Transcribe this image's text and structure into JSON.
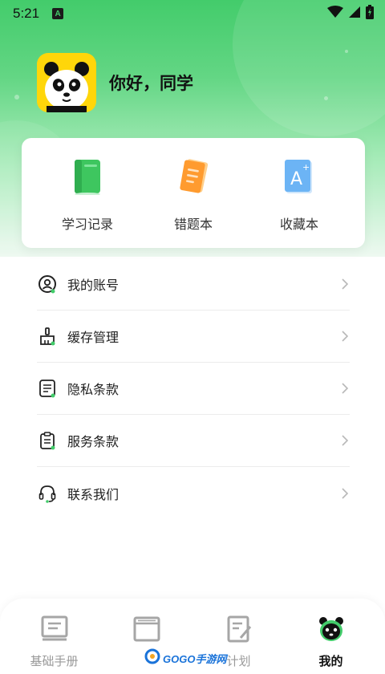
{
  "status_bar": {
    "time": "5:21",
    "notification_letter": "A"
  },
  "profile": {
    "greeting": "你好，同学",
    "avatar_icon": "panda-avatar"
  },
  "quick_actions": [
    {
      "label": "学习记录",
      "icon": "green-book-icon",
      "color": "#3ec65f"
    },
    {
      "label": "错题本",
      "icon": "orange-notebook-icon",
      "color": "#ff9b2f"
    },
    {
      "label": "收藏本",
      "icon": "blue-favorite-icon",
      "color": "#6cb4f5"
    }
  ],
  "menu": [
    {
      "label": "我的账号",
      "icon": "account-icon"
    },
    {
      "label": "缓存管理",
      "icon": "broom-icon"
    },
    {
      "label": "隐私条款",
      "icon": "document-icon"
    },
    {
      "label": "服务条款",
      "icon": "clipboard-icon"
    },
    {
      "label": "联系我们",
      "icon": "headset-icon"
    }
  ],
  "bottom_nav": [
    {
      "label": "基础手册",
      "icon": "manual-icon",
      "active": false
    },
    {
      "label": "",
      "icon": "book-icon",
      "active": false
    },
    {
      "label": "计划",
      "icon": "plan-icon",
      "active": false
    },
    {
      "label": "我的",
      "icon": "panda-icon",
      "active": true
    }
  ],
  "watermark": {
    "text": "GOGO手游网"
  },
  "colors": {
    "accent": "#43cc6b",
    "text": "#1f1f1f",
    "muted": "#9a9a9a"
  }
}
